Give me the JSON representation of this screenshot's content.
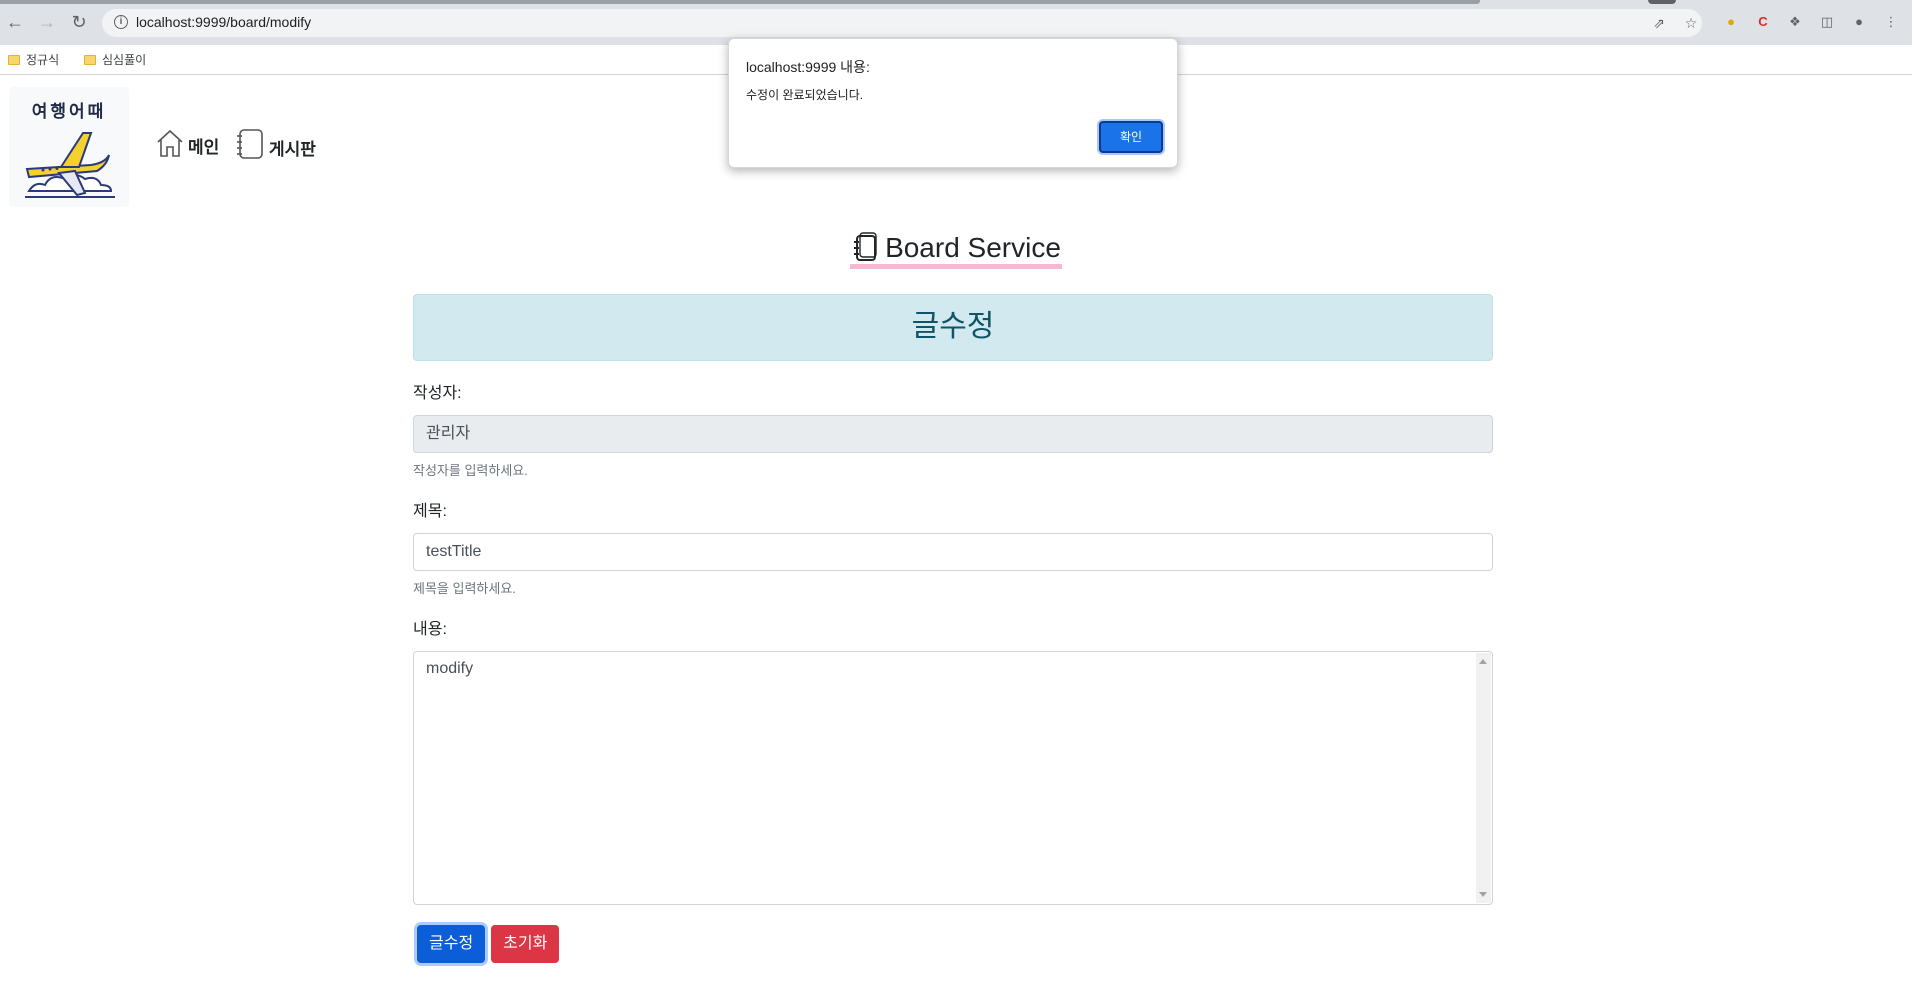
{
  "browser": {
    "url": "localhost:9999/board/modify",
    "bookmarks": [
      "정규식",
      "심심풀이"
    ]
  },
  "logo": {
    "text": "여행어때"
  },
  "nav": {
    "main_label": "메인",
    "board_label": "게시판"
  },
  "page": {
    "board_title": "Board Service",
    "header": "글수정"
  },
  "form": {
    "writer_label": "작성자:",
    "writer_value": "관리자",
    "writer_help": "작성자를 입력하세요.",
    "title_label": "제목:",
    "title_value": "testTitle",
    "title_help": "제목을 입력하세요.",
    "content_label": "내용:",
    "content_value": "modify",
    "submit_label": "글수정",
    "reset_label": "초기화"
  },
  "dialog": {
    "title": "localhost:9999 내용:",
    "message": "수정이 완료되었습니다.",
    "ok_label": "확인"
  },
  "colors": {
    "alert_bg": "#d1e9ef",
    "primary": "#0b5ed7",
    "danger": "#dc3545",
    "title_underline": "#f6b8d4"
  }
}
